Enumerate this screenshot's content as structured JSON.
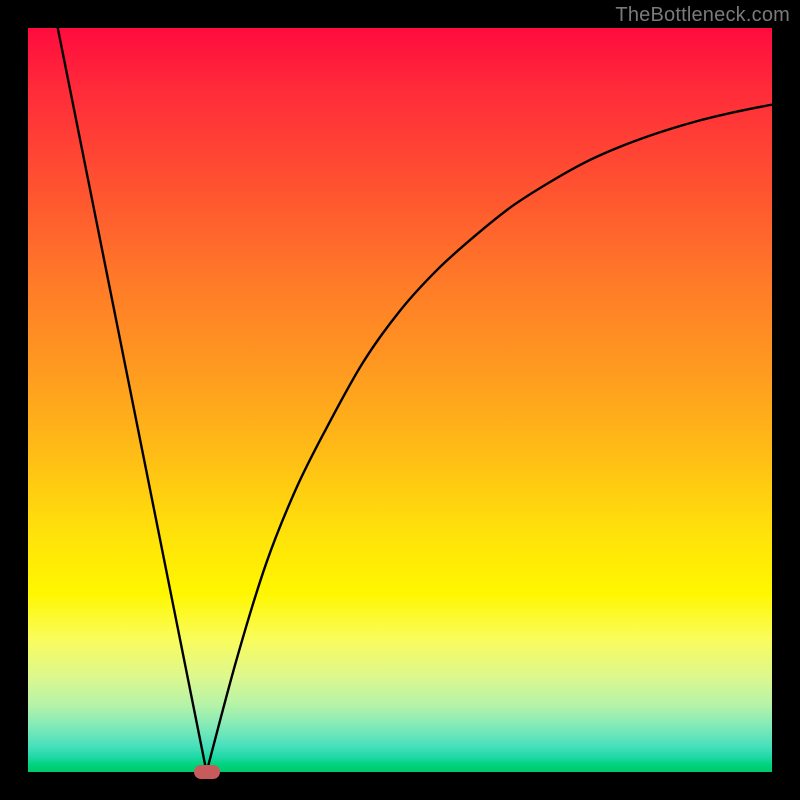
{
  "watermark": "TheBottleneck.com",
  "colors": {
    "page_bg": "#000000",
    "curve": "#000000",
    "marker": "#c75a5a",
    "gradient_top": "#ff0b3e",
    "gradient_bottom": "#00c96c"
  },
  "chart_data": {
    "type": "line",
    "title": "",
    "xlabel": "",
    "ylabel": "",
    "xlim": [
      0,
      100
    ],
    "ylim": [
      0,
      100
    ],
    "annotations": [
      {
        "name": "optimal-point",
        "x": 24,
        "y": 0
      }
    ],
    "series": [
      {
        "name": "falling-branch",
        "x": [
          4,
          8,
          12,
          16,
          20,
          24
        ],
        "y": [
          100,
          80,
          60,
          40,
          20,
          0
        ]
      },
      {
        "name": "rising-branch",
        "x": [
          24,
          28,
          32,
          36,
          40,
          45,
          50,
          55,
          60,
          65,
          70,
          75,
          80,
          85,
          90,
          95,
          100
        ],
        "y": [
          0,
          15,
          28,
          38,
          46,
          55,
          62,
          67.5,
          72,
          76,
          79.2,
          82,
          84.2,
          86,
          87.5,
          88.7,
          89.7
        ]
      }
    ]
  }
}
